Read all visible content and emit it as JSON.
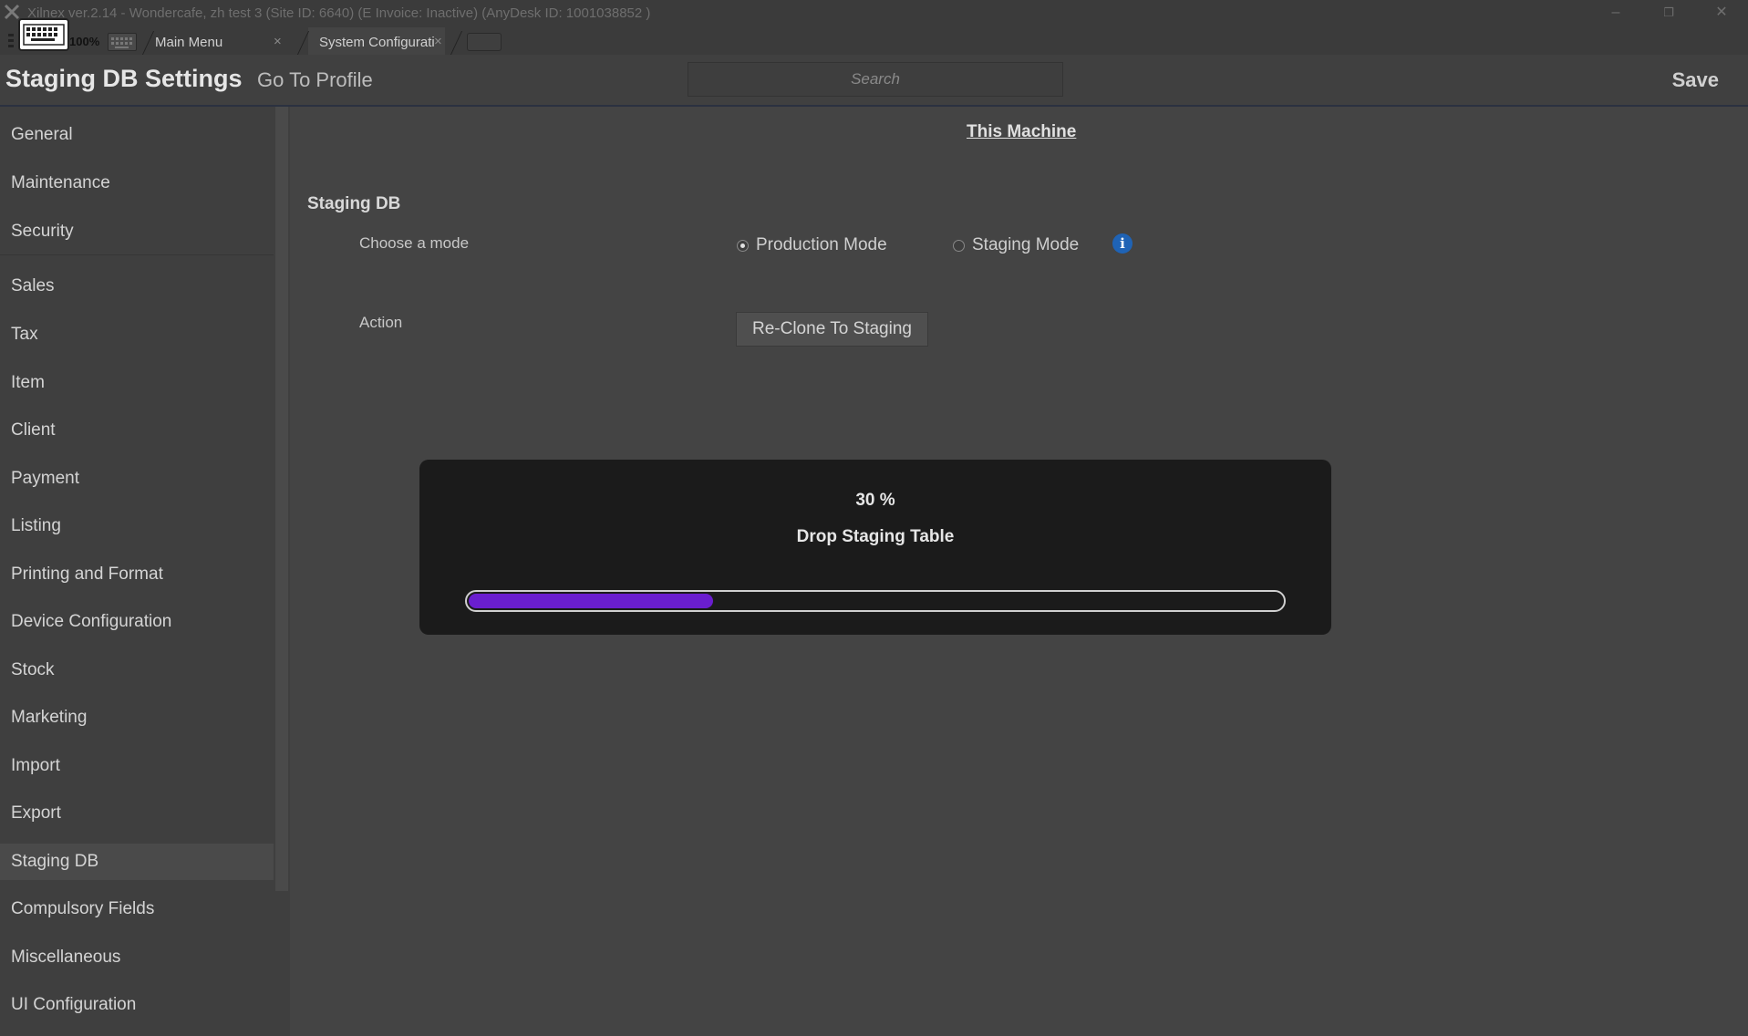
{
  "window": {
    "title": "Xilnex ver.2.14 -  Wondercafe, zh test 3  (Site ID: 6640)  (E Invoice: Inactive) (AnyDesk ID: 1001038852 )",
    "zoom": "100%"
  },
  "tabs": [
    {
      "label": "Main Menu",
      "active": false
    },
    {
      "label": "System Configurati",
      "active": true
    }
  ],
  "header": {
    "title": "Staging DB Settings",
    "goto_profile": "Go To Profile",
    "search_placeholder": "Search",
    "save": "Save"
  },
  "sidebar": {
    "active": "Staging DB",
    "items": [
      "General",
      "Maintenance",
      "Security",
      "Sales",
      "Tax",
      "Item",
      "Client",
      "Payment",
      "Listing",
      "Printing and Format",
      "Device Configuration",
      "Stock",
      "Marketing",
      "Import",
      "Export",
      "Staging DB",
      "Compulsory Fields",
      "Miscellaneous",
      "UI Configuration"
    ]
  },
  "main": {
    "scope_link": "This Machine",
    "section_title": "Staging DB",
    "mode_label": "Choose a mode",
    "modes": [
      {
        "label": "Production Mode",
        "selected": true
      },
      {
        "label": "Staging Mode",
        "selected": false
      }
    ],
    "action_label": "Action",
    "action_button": "Re-Clone To Staging"
  },
  "progress": {
    "percent_text": "30 %",
    "message": "Drop Staging Table",
    "value": 0.3,
    "fill_color": "#6a1ecf"
  },
  "icons": {
    "app_logo": "app-logo-icon",
    "info": "info-icon",
    "keyboard": "keyboard-icon"
  }
}
